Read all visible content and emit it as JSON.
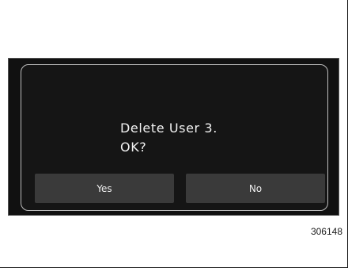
{
  "dialog": {
    "message_line1": "Delete User 3.",
    "message_line2": "OK?",
    "yes_label": "Yes",
    "no_label": "No"
  },
  "figure_number": "306148",
  "colors": {
    "screen_background": "#111111",
    "dialog_border": "#bdbdbd",
    "button_background": "#3a3a3a",
    "text": "#f2f2f2"
  }
}
